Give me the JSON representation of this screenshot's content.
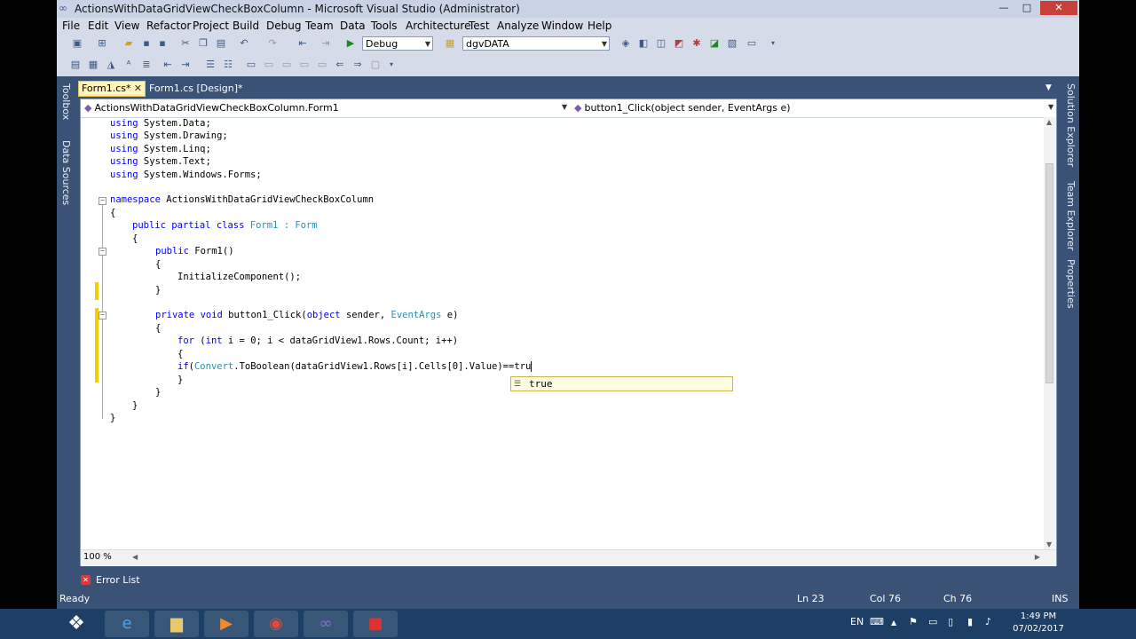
{
  "window": {
    "title": "ActionsWithDataGridViewCheckBoxColumn - Microsoft Visual Studio (Administrator)",
    "app_icon": "visual-studio-icon",
    "controls": {
      "minimize": "—",
      "maximize": "□",
      "close": "✕"
    }
  },
  "menu": [
    "File",
    "Edit",
    "View",
    "Refactor",
    "Project",
    "Build",
    "Debug",
    "Team",
    "Data",
    "Tools",
    "Architecture",
    "Test",
    "Analyze",
    "Window",
    "Help"
  ],
  "toolbar": {
    "config_value": "Debug",
    "find_value": "dgvDATA",
    "icons": [
      "new-project-icon",
      "add-item-icon",
      "open-file-icon",
      "save-icon",
      "save-all-icon",
      "cut-icon",
      "copy-icon",
      "paste-icon",
      "undo-icon",
      "redo-icon",
      "navigate-back-icon",
      "navigate-forward-icon",
      "start-debug-icon"
    ]
  },
  "side_panels": {
    "left": [
      "Toolbox",
      "Data Sources"
    ],
    "right": [
      "Solution Explorer",
      "Team Explorer",
      "Properties"
    ]
  },
  "tabs": [
    {
      "label": "Form1.cs*",
      "active": true,
      "close": "✕"
    },
    {
      "label": "Form1.cs [Design]*",
      "active": false
    }
  ],
  "navigation": {
    "type_selector": "ActionsWithDataGridViewCheckBoxColumn.Form1",
    "member_selector": "button1_Click(object sender, EventArgs e)"
  },
  "code": {
    "using1": {
      "kw": "using",
      "rest": " System.Data;"
    },
    "using2": {
      "kw": "using",
      "rest": " System.Drawing;"
    },
    "using3": {
      "kw": "using",
      "rest": " System.Linq;"
    },
    "using4": {
      "kw": "using",
      "rest": " System.Text;"
    },
    "using5": {
      "kw": "using",
      "rest": " System.Windows.Forms;"
    },
    "ns": {
      "kw": "namespace",
      "rest": " ActionsWithDataGridViewCheckBoxColumn"
    },
    "brace_open": "{",
    "brace_close": "}",
    "class_kw": "public partial class",
    "class_name": " Form1 : ",
    "class_base": "Form",
    "ctor_kw": "public",
    "ctor_rest": " Form1()",
    "init_call": "InitializeComponent();",
    "method_kw": "private void",
    "method_mid": " button1_Click(",
    "method_obj": "object",
    "method_s": " sender, ",
    "method_ea": "EventArgs",
    "method_end": " e)",
    "for_kw": "for",
    "for_mid": " (",
    "for_int": "int",
    "for_rest": " i = 0; i < dataGridView1.Rows.Count; i++)",
    "if_kw": "if",
    "if_mid": "(",
    "if_conv": "Convert",
    "if_rest": ".ToBoolean(dataGridView1.Rows[i].Cells[0].Value)==tru"
  },
  "intellisense": {
    "icon": "keyword-icon",
    "suggestion": "true"
  },
  "editor": {
    "zoom": "100 %"
  },
  "bottom_panel": {
    "label": "Error List"
  },
  "statusbar": {
    "ready": "Ready",
    "ln": "Ln 23",
    "col": "Col 76",
    "ch": "Ch 76",
    "mode": "INS"
  },
  "taskbar": {
    "apps": [
      "internet-explorer-icon",
      "file-explorer-icon",
      "media-player-icon",
      "chrome-icon",
      "visual-studio-icon",
      "recorder-icon"
    ],
    "language": "EN",
    "time": "1:49 PM",
    "date": "07/02/2017"
  },
  "colors": {
    "vs_chrome": "#3b5277",
    "keyword": "#0000ff",
    "type": "#2b91af",
    "active_tab": "#fff3b8"
  }
}
